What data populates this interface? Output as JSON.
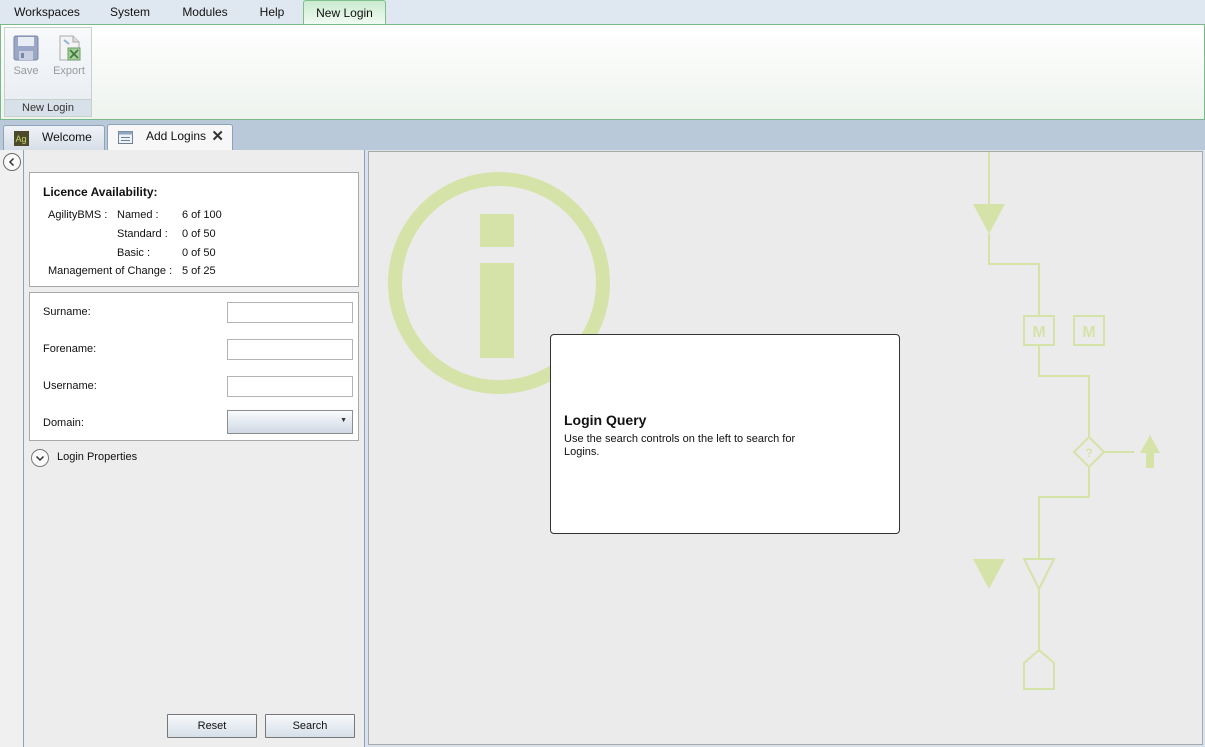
{
  "menu": {
    "items": [
      "Workspaces",
      "System",
      "Modules",
      "Help",
      "New Login"
    ]
  },
  "ribbon": {
    "save_label": "Save",
    "export_label": "Export",
    "group_label": "New Login"
  },
  "tabs": {
    "welcome": "Welcome",
    "add_logins": "Add Logins",
    "close_glyph": "✕"
  },
  "licence": {
    "title": "Licence Availability:",
    "product": "AgilityBMS :",
    "rows": [
      {
        "label": "Named :",
        "value": "6 of 100"
      },
      {
        "label": "Standard :",
        "value": "0 of 50"
      },
      {
        "label": "Basic :",
        "value": "0 of 50"
      }
    ],
    "moc_label": "Management of Change :",
    "moc_value": "5 of 25"
  },
  "search": {
    "surname_label": "Surname:",
    "surname_value": "",
    "forename_label": "Forename:",
    "forename_value": "",
    "username_label": "Username:",
    "username_value": "",
    "domain_label": "Domain:",
    "domain_value": ""
  },
  "login_properties": {
    "label": "Login Properties"
  },
  "buttons": {
    "reset": "Reset",
    "search": "Search"
  },
  "query": {
    "title": "Login Query",
    "text": "Use the search controls on the left to search for Logins."
  },
  "decoration": {
    "info_glyph": "i",
    "m_label_1": "M",
    "m_label_2": "M",
    "q_label": "?"
  },
  "colors": {
    "accent_green": "#7fbf8e",
    "deco_green": "#d6e3a8",
    "panel_bg": "#ededed"
  },
  "icons": {
    "save": "floppy-disk-icon",
    "export": "excel-export-icon",
    "welcome": "agility-logo-icon",
    "add_logins": "form-icon",
    "collapse": "chevron-left-icon",
    "expand": "chevron-down-icon"
  }
}
